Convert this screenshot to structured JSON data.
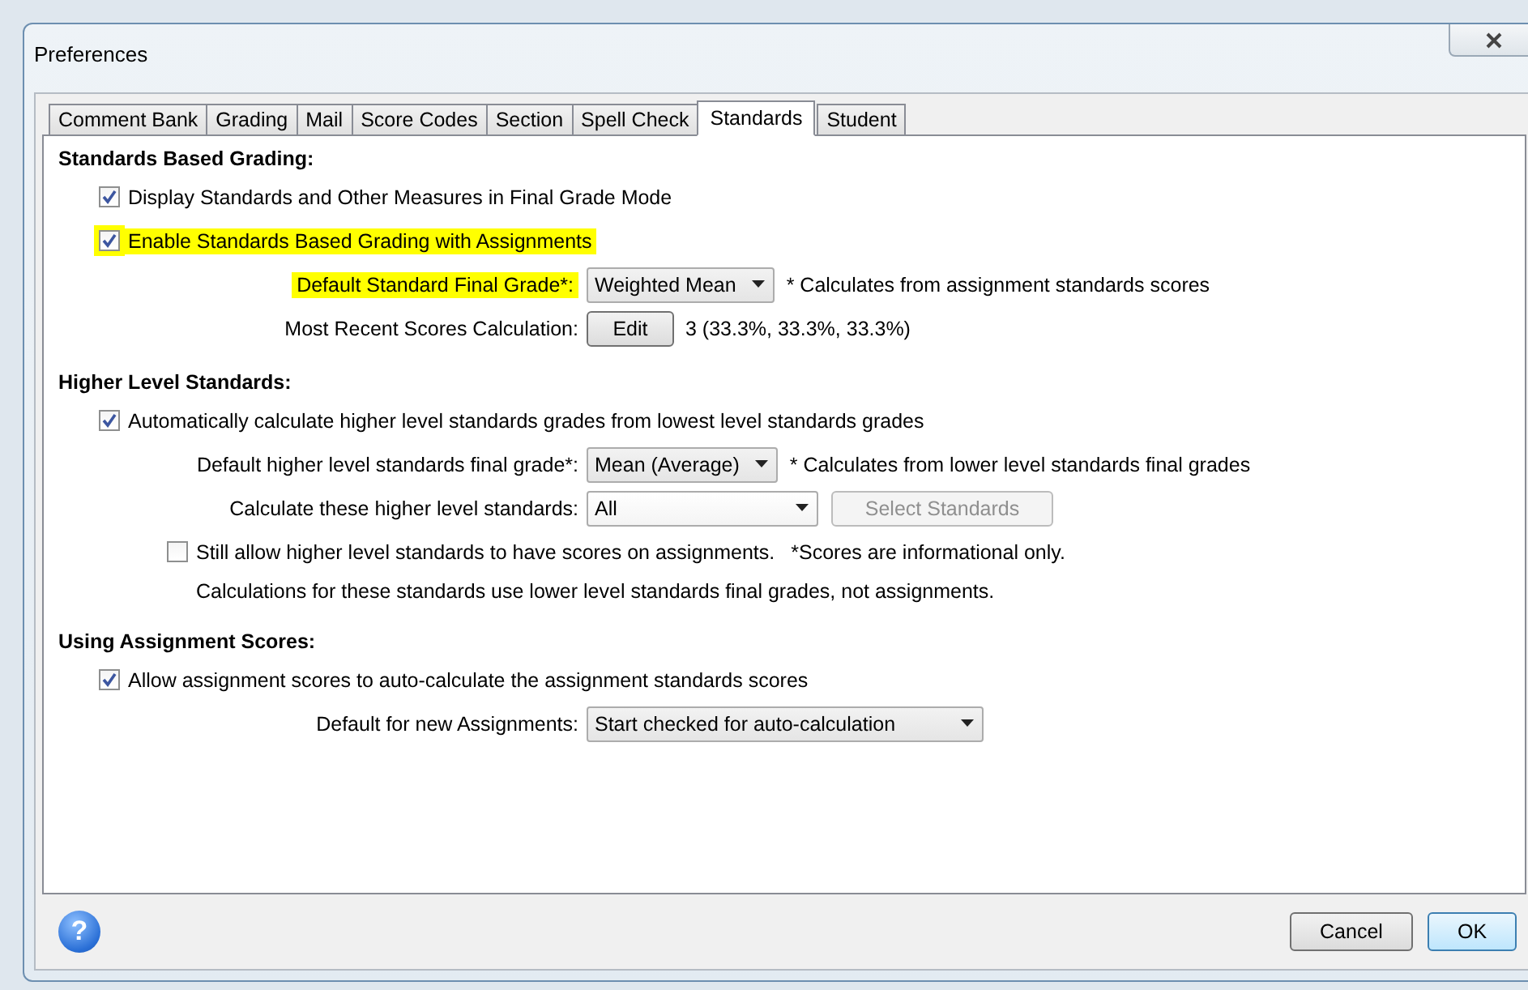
{
  "window": {
    "title": "Preferences"
  },
  "tabs": [
    {
      "label": "Comment Bank",
      "selected": false
    },
    {
      "label": "Grading",
      "selected": false
    },
    {
      "label": "Mail",
      "selected": false
    },
    {
      "label": "Score Codes",
      "selected": false
    },
    {
      "label": "Section",
      "selected": false
    },
    {
      "label": "Spell Check",
      "selected": false
    },
    {
      "label": "Standards",
      "selected": true
    },
    {
      "label": "Student",
      "selected": false
    }
  ],
  "sections": [
    {
      "title": "Standards Based Grading:",
      "rows": [
        {
          "kind": "checkbox",
          "label": "Display Standards and Other Measures in Final Grade Mode",
          "checked": true,
          "highlighted": false
        },
        {
          "kind": "checkbox",
          "label": "Enable Standards Based Grading with Assignments",
          "checked": true,
          "highlighted": true
        },
        {
          "kind": "select",
          "label": "Default Standard Final Grade*:",
          "value": "Weighted Mean",
          "note": "* Calculates from assignment standards scores",
          "highlighted": true
        },
        {
          "kind": "button",
          "label": "Most Recent Scores Calculation:",
          "button": "Edit",
          "note": "3 (33.3%, 33.3%, 33.3%)"
        }
      ]
    },
    {
      "title": "Higher Level Standards:",
      "rows": [
        {
          "kind": "checkbox",
          "label": "Automatically calculate higher level standards grades from lowest level standards grades",
          "checked": true,
          "highlighted": false
        },
        {
          "kind": "select",
          "label": "Default higher level standards final grade*:",
          "value": "Mean (Average)",
          "note": "* Calculates from lower level standards final grades",
          "highlighted": false
        },
        {
          "kind": "select",
          "label": "Calculate these higher level standards:",
          "value": "All",
          "action": {
            "label": "Select Standards",
            "disabled": true
          },
          "highlighted": false
        },
        {
          "kind": "sub_checkbox",
          "label": "Still allow higher level standards to have scores on assignments.",
          "note": "*Scores are informational only.",
          "checked": false,
          "highlighted": false
        },
        {
          "kind": "sub_note",
          "text": "Calculations for these standards use lower level standards final grades, not assignments."
        }
      ]
    },
    {
      "title": "Using Assignment Scores:",
      "rows": [
        {
          "kind": "checkbox",
          "label": "Allow assignment scores to auto-calculate the assignment standards scores",
          "checked": true,
          "highlighted": false
        },
        {
          "kind": "select",
          "label": "Default for new Assignments:",
          "value": "Start checked for auto-calculation",
          "highlighted": false
        }
      ]
    }
  ],
  "help": "?",
  "buttons": [
    {
      "label": "Cancel",
      "default": false
    },
    {
      "label": "OK",
      "default": true
    }
  ]
}
